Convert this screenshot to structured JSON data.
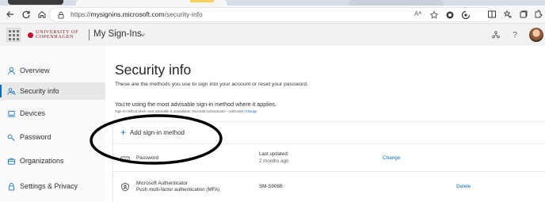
{
  "browser": {
    "url_prefix": "https://",
    "url_host": "mysignins.microsoft.com",
    "url_path": "/security-info",
    "read_aloud": "Aᴬ",
    "icons": [
      "back-icon",
      "refresh-icon",
      "lock-icon",
      "read-aloud-icon",
      "favorite-icon",
      "extension-icon",
      "copilot-icon",
      "split-screen-icon",
      "favorites-bar-icon",
      "collections-icon",
      "extensions-icon"
    ]
  },
  "header": {
    "logo_line1": "UNIVERSITY OF",
    "logo_line2": "COPENHAGEN",
    "title": "My Sign-Ins",
    "help": "?"
  },
  "sidebar": {
    "items": [
      {
        "label": "Overview",
        "icon": "person-icon"
      },
      {
        "label": "Security info",
        "icon": "key-person-icon"
      },
      {
        "label": "Devices",
        "icon": "laptop-icon"
      },
      {
        "label": "Password",
        "icon": "key-icon"
      },
      {
        "label": "Organizations",
        "icon": "briefcase-icon"
      },
      {
        "label": "Settings & Privacy",
        "icon": "lock-icon"
      }
    ],
    "active_index": 1
  },
  "main": {
    "title": "Security info",
    "description": "These are the methods you use to sign into your account or reset your password.",
    "advisable": "You're using the most advisable sign-in method where it applies.",
    "default_line": "Sign-in method when most advisable is unavailable: Microsoft Authenticator - notification",
    "default_change": "Change",
    "add_method": "Add sign-in method",
    "methods": [
      {
        "name": "Password",
        "sub": "",
        "meta_label": "Last updated:",
        "meta_value": "2 months ago",
        "action": "Change",
        "icon": "password-icon"
      },
      {
        "name": "Microsoft Authenticator",
        "sub": "Push multi-factor authentication (MFA)",
        "meta_label": "SM-S908B",
        "meta_value": "",
        "action": "Delete",
        "icon": "authenticator-icon"
      }
    ]
  },
  "colors": {
    "accent": "#0f6cbd",
    "annotation": "#000000",
    "logo": "#c8102e"
  }
}
